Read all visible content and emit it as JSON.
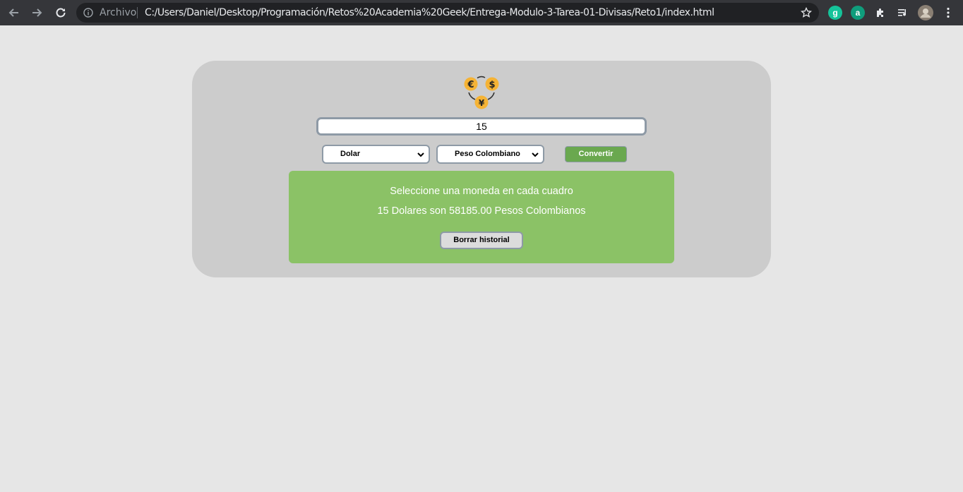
{
  "browser": {
    "protocol_label": "Archivo",
    "url": "C:/Users/Daniel/Desktop/Programación/Retos%20Academia%20Geek/Entrega-Modulo-3-Tarea-01-Divisas/Reto1/index.html",
    "extensions": [
      {
        "name": "grammarly-icon",
        "glyph": "g",
        "color": "#15c39a"
      },
      {
        "name": "a-extension-icon",
        "glyph": "a",
        "color": "#0f9d7c"
      }
    ]
  },
  "app": {
    "logo": {
      "symbols": [
        "€",
        "$",
        "¥"
      ],
      "coin_color": "#f5b335"
    },
    "amount_value": "15",
    "from_currency": "Dolar",
    "to_currency": "Peso Colombiano",
    "convert_label": "Convertir",
    "result": {
      "message": "Seleccione una moneda en cada cuadro",
      "conversion": "15 Dolares son 58185.00 Pesos Colombianos",
      "clear_label": "Borrar historial"
    }
  },
  "colors": {
    "page_bg": "#e6e6e6",
    "card_bg": "#cccccc",
    "result_bg": "#8bc266",
    "convert_bg": "#6aa84f"
  }
}
